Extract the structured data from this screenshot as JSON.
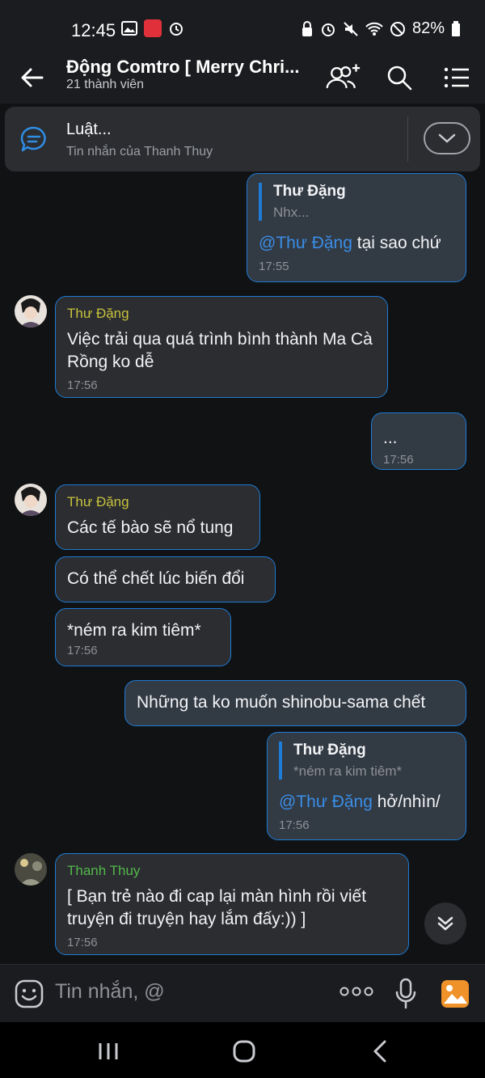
{
  "status": {
    "time": "12:45",
    "battery": "82%"
  },
  "header": {
    "title": "Động Comtro [ Merry Chri...",
    "subtitle": "21 thành viên"
  },
  "pinned": {
    "title": "Luật...",
    "subtitle": "Tin nhắn của Thanh Thuy"
  },
  "messages": [
    {
      "quote_name": "Thư Đặng",
      "quote_text": "Nhx...",
      "mention": "@Thư Đặng",
      "text": " tại sao chứ",
      "time": "17:55"
    },
    {
      "sender": "Thư Đặng",
      "text": "Việc trải qua quá trình bình thành Ma Cà Rồng ko dễ",
      "time": "17:56"
    },
    {
      "text": "...",
      "time": "17:56"
    },
    {
      "sender": "Thư Đặng",
      "text": "Các tế bào sẽ nổ tung"
    },
    {
      "text": "Có thể chết lúc biến đổi"
    },
    {
      "text": "*ném ra kim tiêm*",
      "time": "17:56"
    },
    {
      "text": "Những ta ko muốn shinobu-sama chết"
    },
    {
      "quote_name": "Thư Đặng",
      "quote_text": "*ném ra kim tiêm*",
      "mention": "@Thư Đặng",
      "text": " hở/nhìn/",
      "time": "17:56"
    },
    {
      "sender": "Thanh Thuy",
      "text": "[ Bạn trẻ nào đi cap lại màn hình rồi viết truyện đi truyện hay lắm đấy:)) ]",
      "time": "17:56"
    }
  ],
  "composer": {
    "placeholder": "Tin nhắn, @"
  },
  "colors": {
    "accent": "#1e7bd6",
    "mention": "#3a8ee6",
    "sender_yellow": "#c8c23c",
    "sender_green": "#53b84a"
  },
  "icons": [
    "back-arrow-icon",
    "add-member-icon",
    "search-icon",
    "menu-icon",
    "chat-bubble-icon",
    "chevron-down-icon",
    "emoji-icon",
    "more-icon",
    "mic-icon",
    "image-icon"
  ]
}
